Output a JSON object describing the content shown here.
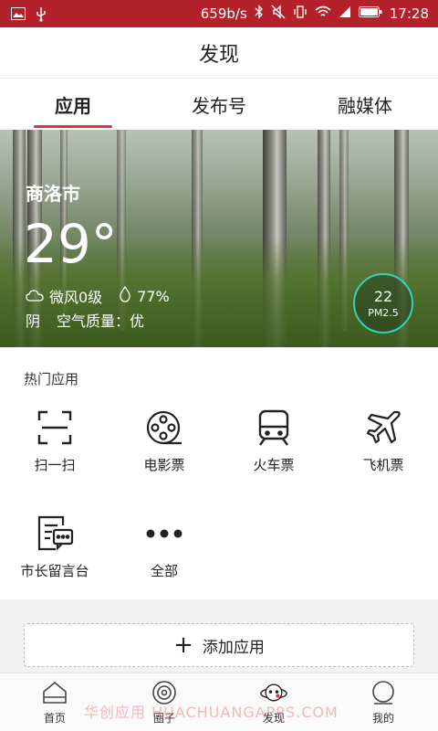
{
  "status_bar": {
    "network_speed": "659b/s",
    "time": "17:28"
  },
  "title": "发现",
  "tabs": [
    {
      "label": "应用",
      "active": true
    },
    {
      "label": "发布号",
      "active": false
    },
    {
      "label": "融媒体",
      "active": false
    }
  ],
  "weather": {
    "city": "商洛市",
    "temperature": "29°",
    "wind": "微风0级",
    "humidity": "77%",
    "condition": "阴",
    "air_quality": "空气质量：优",
    "pm_value": "22",
    "pm_label": "PM2.5"
  },
  "hot_apps": {
    "title": "热门应用",
    "items": [
      {
        "label": "扫一扫",
        "icon": "scan-icon"
      },
      {
        "label": "电影票",
        "icon": "film-reel-icon"
      },
      {
        "label": "火车票",
        "icon": "train-icon"
      },
      {
        "label": "飞机票",
        "icon": "airplane-icon"
      },
      {
        "label": "市长留言台",
        "icon": "message-board-icon"
      },
      {
        "label": "全部",
        "icon": "more-dots-icon"
      }
    ]
  },
  "add_app": {
    "label": "添加应用"
  },
  "bottom_nav": [
    {
      "label": "首页",
      "icon": "home-icon",
      "active": false
    },
    {
      "label": "圈子",
      "icon": "circle-icon",
      "active": false
    },
    {
      "label": "发现",
      "icon": "planet-icon",
      "active": true
    },
    {
      "label": "我的",
      "icon": "profile-icon",
      "active": false
    }
  ],
  "watermark": "华创应用 HUACHUANGAPPS.COM",
  "colors": {
    "status_bar": "#b3222a",
    "tab_indicator": "#d9363e",
    "pm_ring": "#2fd3b8"
  }
}
